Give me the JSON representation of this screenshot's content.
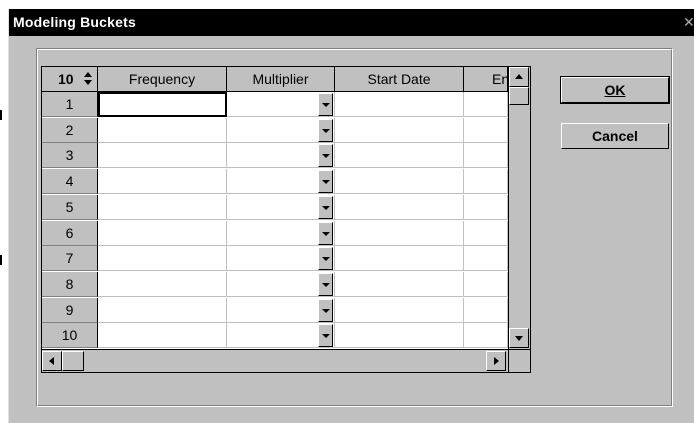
{
  "window": {
    "title": "Modeling Buckets",
    "close_glyph": "✕"
  },
  "grid": {
    "row_count": "10",
    "columns": [
      {
        "label": "Frequency"
      },
      {
        "label": "Multiplier"
      },
      {
        "label": "Start Date"
      },
      {
        "label": "En"
      }
    ],
    "rows": [
      "1",
      "2",
      "3",
      "4",
      "5",
      "6",
      "7",
      "8",
      "9",
      "10"
    ]
  },
  "buttons": {
    "ok": "OK",
    "cancel": "Cancel"
  },
  "icons": {
    "spin": "spin-up-down-icon",
    "dropdown": "chevron-down-icon",
    "scroll_up": "scroll-up-icon",
    "scroll_down": "scroll-down-icon",
    "scroll_left": "scroll-left-icon",
    "scroll_right": "scroll-right-icon"
  }
}
